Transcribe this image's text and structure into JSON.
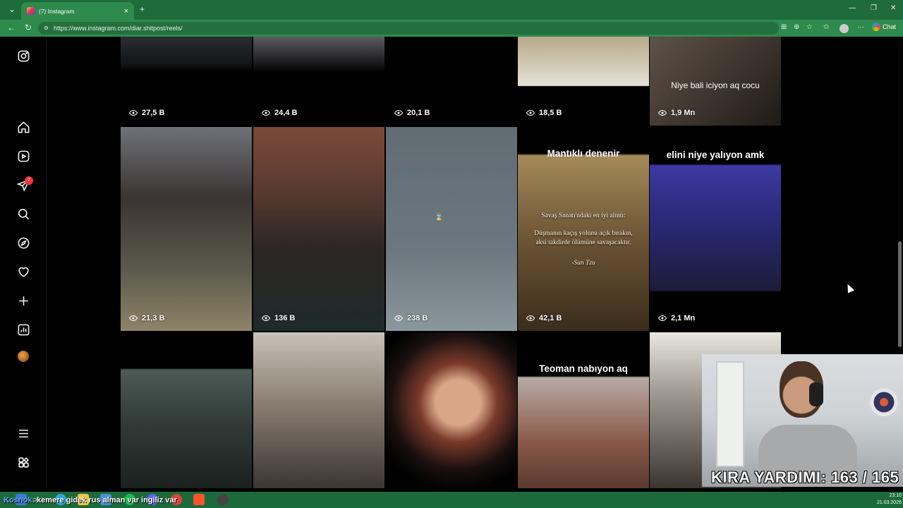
{
  "browser": {
    "tab_title": "(7) Instagram",
    "url": "https://www.instagram.com/diar.shitpost/reels/",
    "chat_label": "Chat"
  },
  "sidebar": {
    "items": [
      {
        "name": "instagram-logo-icon"
      },
      {
        "name": "home-icon"
      },
      {
        "name": "reels-icon"
      },
      {
        "name": "messages-icon",
        "badge": "7"
      },
      {
        "name": "search-icon"
      },
      {
        "name": "explore-icon"
      },
      {
        "name": "notifications-icon"
      },
      {
        "name": "create-icon"
      },
      {
        "name": "dashboard-icon"
      },
      {
        "name": "profile-avatar"
      },
      {
        "name": "more-menu-icon"
      },
      {
        "name": "also-from-meta-icon"
      }
    ]
  },
  "reels": {
    "row1": [
      {
        "views": "27,5 B"
      },
      {
        "views": "24,4 B"
      },
      {
        "views": "20,1 B"
      },
      {
        "views": "18,5 B"
      },
      {
        "views": "1,9 Mn",
        "caption": "Niye bali iciyon aq cocu"
      }
    ],
    "row2": [
      {
        "views": "21,3 B"
      },
      {
        "views": "136 B"
      },
      {
        "views": "238 B"
      },
      {
        "views": "42,1 B",
        "caption": "Mantıklı denenir",
        "quote_title": "Savaş Sanatı'ndaki en iyi alıntı:",
        "quote_body": "Düşmanın kaçış yolunu açık bırakın, aksi takdirde ölümüne savaşacaktır.",
        "quote_author": "-Sun Tzu"
      },
      {
        "views": "2,1 Mn",
        "caption": "elini niye yalıyon amk"
      }
    ],
    "row3": [
      {},
      {},
      {},
      {
        "caption": "Teoman nabıyon aq"
      },
      {}
    ]
  },
  "overlay": {
    "kira_text": "KIRA YARDIMI: 163 / 165",
    "ticker_user": "Kosnok:",
    "ticker_message": " kemere gidek rus alman var ingiliz var"
  },
  "taskbar": {
    "time": "23:10",
    "date": "21.03.2026"
  },
  "colors": {
    "browser_green": "#2e8a4d",
    "tab_bar_green": "#1f6b3a",
    "instagram_bg": "#000000",
    "badge_red": "#ff3040"
  }
}
